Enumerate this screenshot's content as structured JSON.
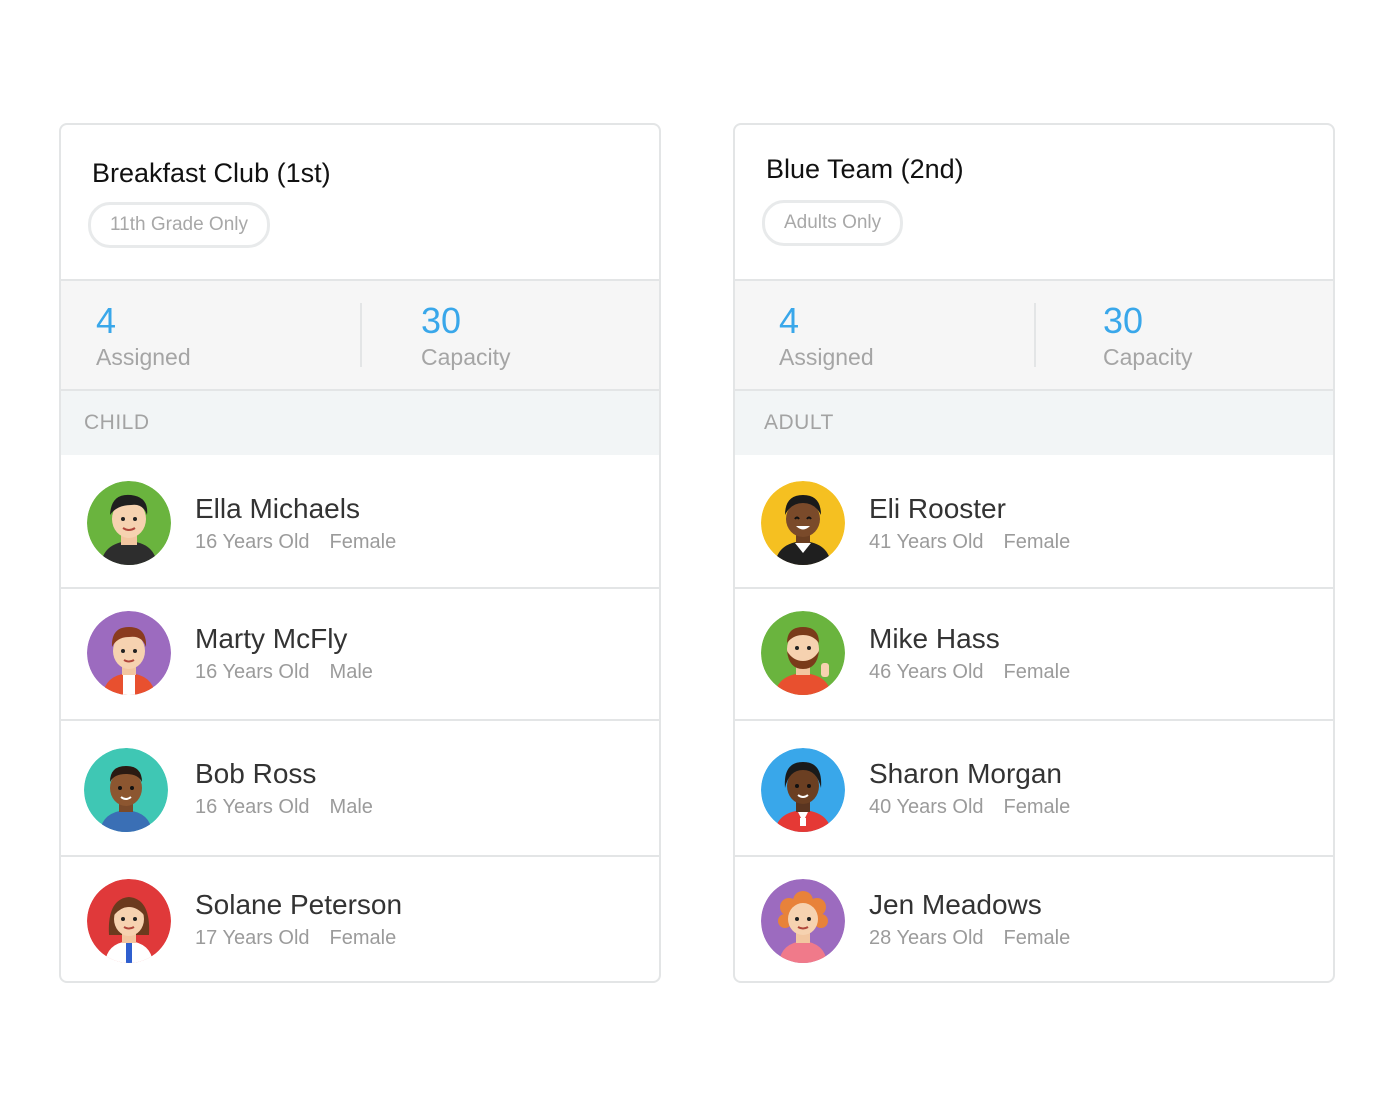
{
  "groups": [
    {
      "title": "Breakfast Club (1st)",
      "tag": "11th Grade Only",
      "assigned_value": "4",
      "assigned_label": "Assigned",
      "capacity_value": "30",
      "capacity_label": "Capacity",
      "section": "CHILD",
      "members": [
        {
          "name": "Ella Michaels",
          "age": "16 Years Old",
          "gender": "Female",
          "avatar_bg": "#6ab43e"
        },
        {
          "name": "Marty McFly",
          "age": "16 Years Old",
          "gender": "Male",
          "avatar_bg": "#9c6bbf"
        },
        {
          "name": "Bob Ross",
          "age": "16 Years Old",
          "gender": "Male",
          "avatar_bg": "#3fc7b4"
        },
        {
          "name": "Solane Peterson",
          "age": "17 Years Old",
          "gender": "Female",
          "avatar_bg": "#e0393a"
        }
      ]
    },
    {
      "title": "Blue Team (2nd)",
      "tag": "Adults Only",
      "assigned_value": "4",
      "assigned_label": "Assigned",
      "capacity_value": "30",
      "capacity_label": "Capacity",
      "section": "ADULT",
      "members": [
        {
          "name": "Eli Rooster",
          "age": "41 Years Old",
          "gender": "Female",
          "avatar_bg": "#f5c021"
        },
        {
          "name": "Mike Hass",
          "age": "46 Years Old",
          "gender": "Female",
          "avatar_bg": "#6ab43e"
        },
        {
          "name": "Sharon Morgan",
          "age": "40 Years Old",
          "gender": "Female",
          "avatar_bg": "#39a7ea"
        },
        {
          "name": "Jen Meadows",
          "age": "28 Years Old",
          "gender": "Female",
          "avatar_bg": "#9c6bbf"
        }
      ]
    }
  ],
  "colors": {
    "accent": "#39a7ea",
    "border": "#e3e5e6",
    "stats_bg": "#f6f6f6",
    "section_bg": "#f2f5f6",
    "muted_text": "#a5a5a5"
  }
}
